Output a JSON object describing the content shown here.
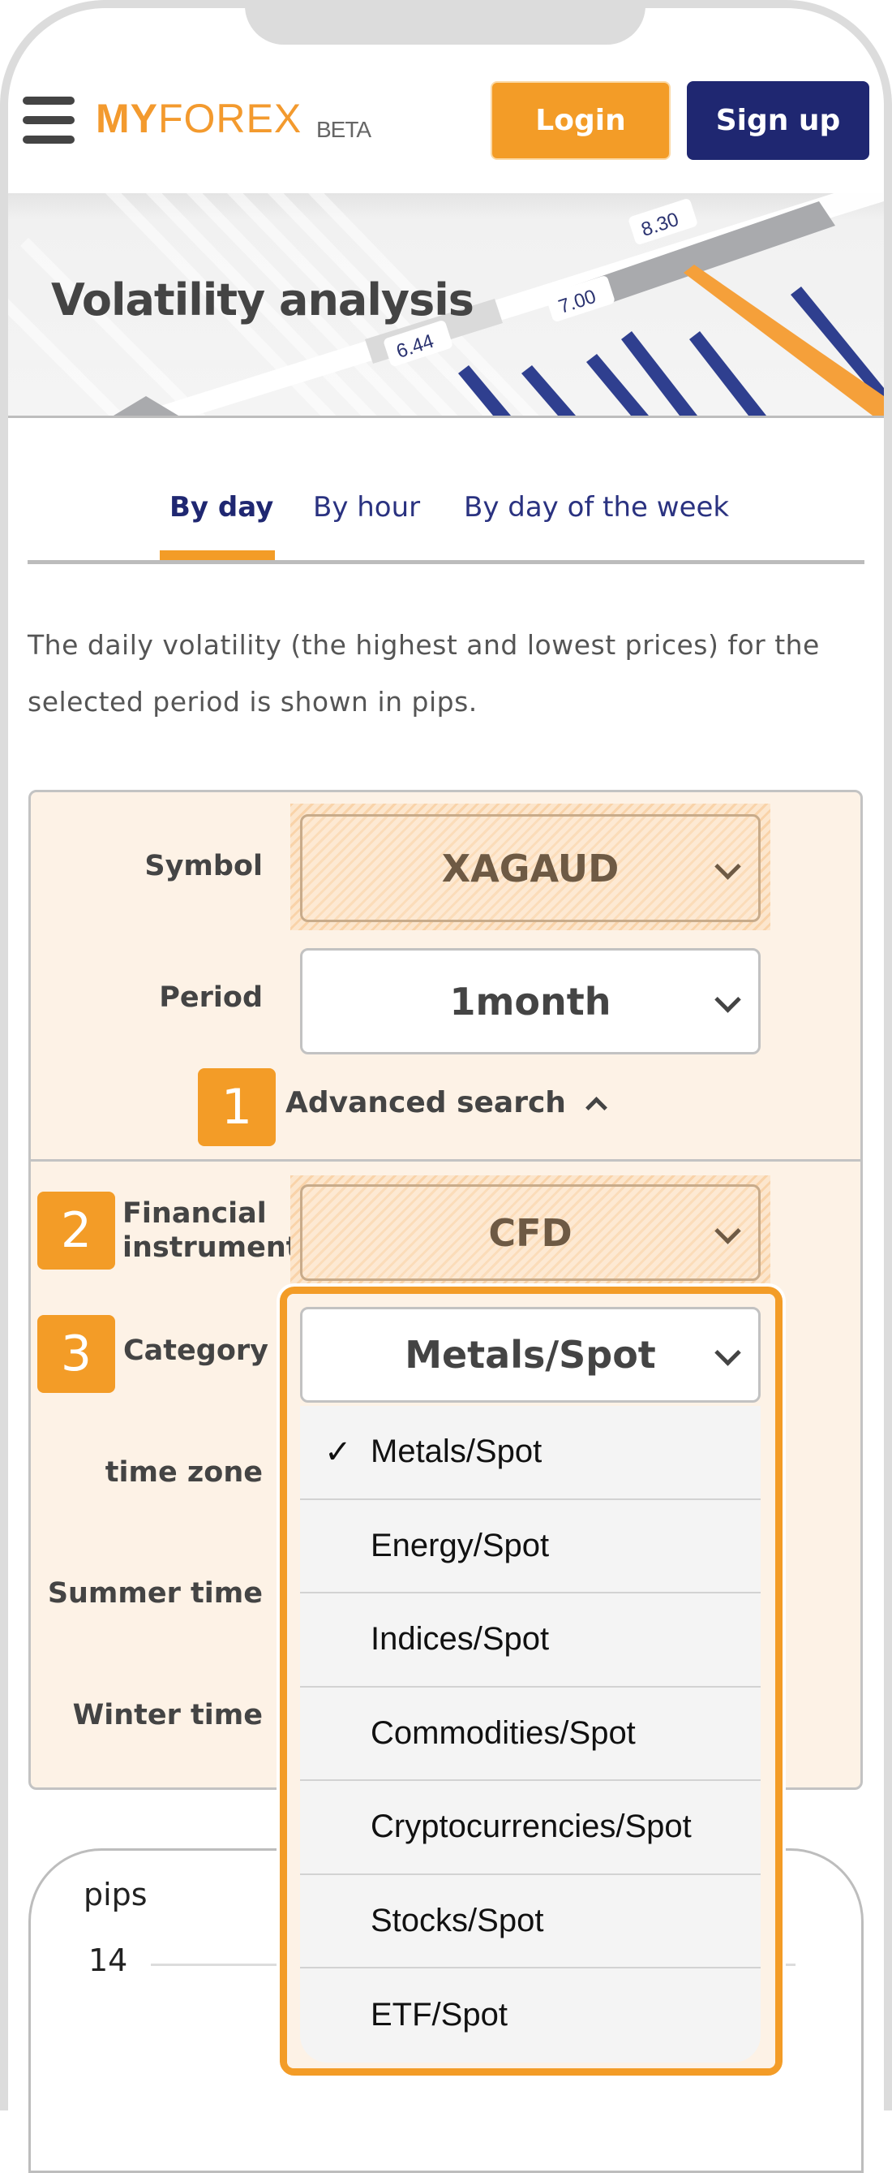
{
  "header": {
    "menu_icon": "hamburger-icon",
    "logo_bold": "MY",
    "logo_light": "FOREX",
    "logo_badge": "BETA",
    "login_label": "Login",
    "signup_label": "Sign up",
    "colors": {
      "accent": "#f39c27",
      "brand_navy": "#1f2771"
    }
  },
  "banner": {
    "title": "Volatility analysis",
    "decor_labels": [
      "6.44",
      "7.00",
      "8.30"
    ]
  },
  "tabs": [
    {
      "label": "By day",
      "active": true
    },
    {
      "label": "By hour",
      "active": false
    },
    {
      "label": "By day of the week",
      "active": false
    }
  ],
  "description": "The daily volatility (the highest and lowest prices) for the selected period is shown in pips.",
  "form": {
    "symbol": {
      "label": "Symbol",
      "value": "XAGAUD"
    },
    "period": {
      "label": "Period",
      "value": "1month"
    },
    "advanced_search": {
      "badge": "1",
      "label": "Advanced search",
      "icon": "chevron-up-icon"
    },
    "financial_instrument": {
      "badge": "2",
      "label_line1": "Financial",
      "label_line2": "instrument",
      "value": "CFD"
    },
    "category": {
      "badge": "3",
      "label": "Category",
      "value": "Metals/Spot",
      "options": [
        {
          "label": "Metals/Spot",
          "selected": true,
          "check": "✓"
        },
        {
          "label": "Energy/Spot",
          "selected": false
        },
        {
          "label": "Indices/Spot",
          "selected": false
        },
        {
          "label": "Commodities/Spot",
          "selected": false
        },
        {
          "label": "Cryptocurrencies/Spot",
          "selected": false
        },
        {
          "label": "Stocks/Spot",
          "selected": false
        },
        {
          "label": "ETF/Spot",
          "selected": false
        }
      ]
    },
    "time_zone": {
      "label": "time zone"
    },
    "summer_time": {
      "label": "Summer time"
    },
    "winter_time": {
      "label": "Winter time"
    }
  },
  "chart": {
    "y_unit": "pips",
    "y_ticks": [
      "14"
    ]
  }
}
